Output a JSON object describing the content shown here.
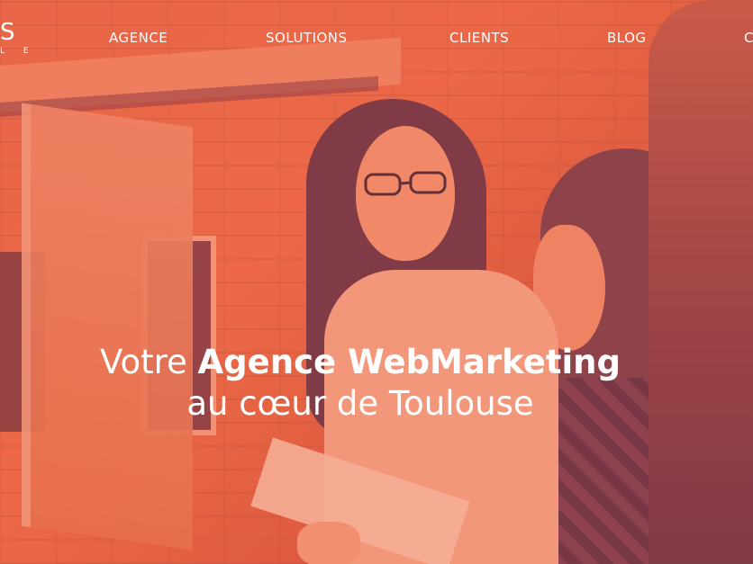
{
  "logo": {
    "text": "S",
    "subtext": "L E"
  },
  "nav": {
    "items": [
      {
        "label": "AGENCE"
      },
      {
        "label": "SOLUTIONS"
      },
      {
        "label": "CLIENTS"
      },
      {
        "label": "BLOG"
      },
      {
        "label": "C"
      }
    ]
  },
  "hero": {
    "line1_prefix": "Votre",
    "line1_bold": "Agence WebMarketing",
    "line2": "au cœur de Toulouse"
  },
  "colors": {
    "overlay": "#e96a48",
    "text": "#ffffff"
  }
}
